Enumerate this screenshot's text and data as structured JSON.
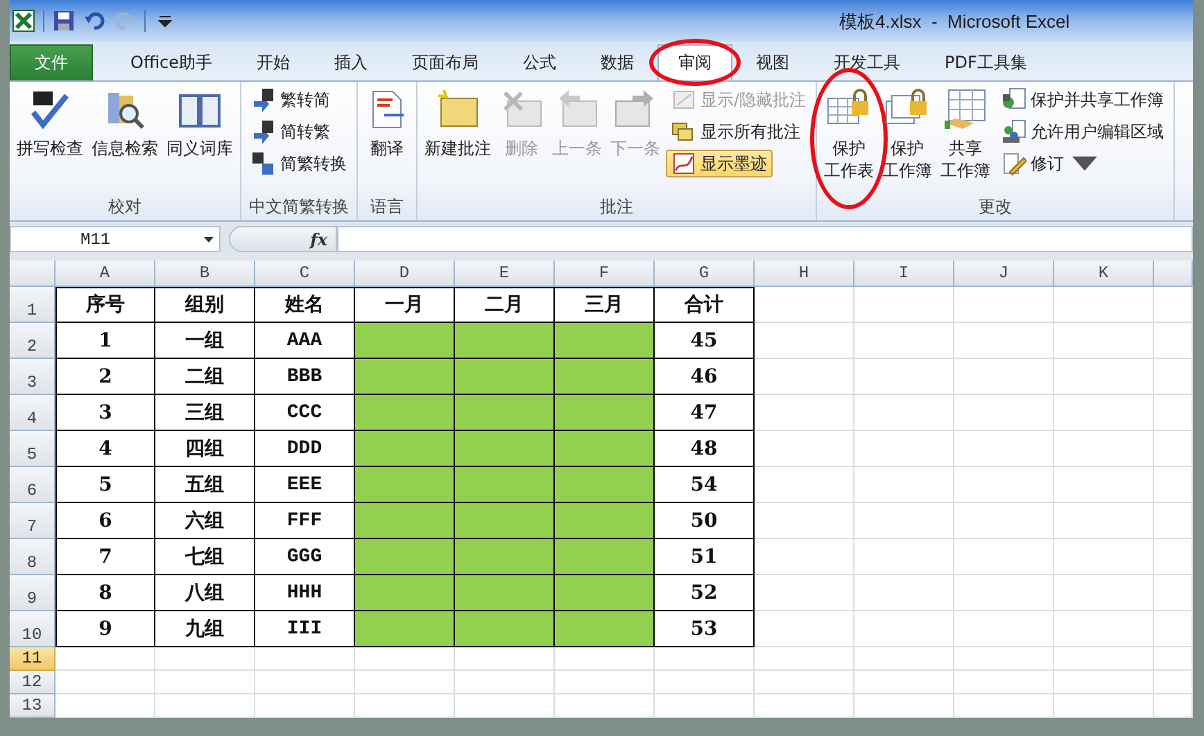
{
  "window": {
    "title": "模板4.xlsx  -  Microsoft Excel"
  },
  "tabs": [
    {
      "label": "文件",
      "kind": "file",
      "selected": false,
      "circled": false
    },
    {
      "label": "Office助手",
      "kind": "tab",
      "selected": false,
      "circled": false
    },
    {
      "label": "开始",
      "kind": "tab",
      "selected": false,
      "circled": false
    },
    {
      "label": "插入",
      "kind": "tab",
      "selected": false,
      "circled": false
    },
    {
      "label": "页面布局",
      "kind": "tab",
      "selected": false,
      "circled": false
    },
    {
      "label": "公式",
      "kind": "tab",
      "selected": false,
      "circled": false
    },
    {
      "label": "数据",
      "kind": "tab",
      "selected": false,
      "circled": false
    },
    {
      "label": "审阅",
      "kind": "tab",
      "selected": true,
      "circled": true
    },
    {
      "label": "视图",
      "kind": "tab",
      "selected": false,
      "circled": false
    },
    {
      "label": "开发工具",
      "kind": "tab",
      "selected": false,
      "circled": false
    },
    {
      "label": "PDF工具集",
      "kind": "tab",
      "selected": false,
      "circled": false
    }
  ],
  "ribbon": {
    "groups": [
      {
        "label": "校对",
        "items": [
          {
            "label": "拼写检查",
            "kind": "large",
            "disabled": false,
            "on": false,
            "circled": false
          },
          {
            "label": "信息检索",
            "kind": "large",
            "disabled": false,
            "on": false,
            "circled": false
          },
          {
            "label": "同义词库",
            "kind": "large",
            "disabled": false,
            "on": false,
            "circled": false
          }
        ]
      },
      {
        "label": "中文简繁转换",
        "items": [
          {
            "label": "繁转简",
            "kind": "small",
            "disabled": false,
            "on": false,
            "circled": false
          },
          {
            "label": "简转繁",
            "kind": "small",
            "disabled": false,
            "on": false,
            "circled": false
          },
          {
            "label": "简繁转换",
            "kind": "small",
            "disabled": false,
            "on": false,
            "circled": false
          }
        ]
      },
      {
        "label": "语言",
        "items": [
          {
            "label": "翻译",
            "kind": "large",
            "disabled": false,
            "on": false,
            "circled": false
          }
        ]
      },
      {
        "label": "批注",
        "items": [
          {
            "label": "新建批注",
            "kind": "large",
            "disabled": false,
            "on": false,
            "circled": false
          },
          {
            "label": "删除",
            "kind": "large",
            "disabled": true,
            "on": false,
            "circled": false
          },
          {
            "label": "上一条",
            "kind": "large",
            "disabled": true,
            "on": false,
            "circled": false
          },
          {
            "label": "下一条",
            "kind": "large",
            "disabled": true,
            "on": false,
            "circled": false
          },
          {
            "label": "显示/隐藏批注",
            "kind": "small",
            "disabled": true,
            "on": false,
            "circled": false
          },
          {
            "label": "显示所有批注",
            "kind": "small",
            "disabled": false,
            "on": false,
            "circled": false
          },
          {
            "label": "显示墨迹",
            "kind": "small",
            "disabled": false,
            "on": true,
            "circled": false
          }
        ]
      },
      {
        "label": "更改",
        "items": [
          {
            "lines": [
              "保护",
              "工作表"
            ],
            "kind": "large",
            "disabled": false,
            "on": false,
            "circled": true
          },
          {
            "lines": [
              "保护",
              "工作簿"
            ],
            "kind": "large",
            "disabled": false,
            "on": false,
            "circled": false
          },
          {
            "lines": [
              "共享",
              "工作簿"
            ],
            "kind": "large",
            "disabled": false,
            "on": false,
            "circled": false
          },
          {
            "label": "保护并共享工作簿",
            "kind": "small",
            "disabled": false,
            "on": false,
            "circled": false
          },
          {
            "label": "允许用户编辑区域",
            "kind": "small",
            "disabled": false,
            "on": false,
            "circled": false
          },
          {
            "label": "修订",
            "kind": "dropdown",
            "disabled": false,
            "on": false,
            "circled": false
          }
        ]
      }
    ]
  },
  "formula_bar": {
    "name_box": "M11",
    "function_label": "fx"
  },
  "sheet": {
    "columns": [
      "A",
      "B",
      "C",
      "D",
      "E",
      "F",
      "G",
      "H",
      "I",
      "J",
      "K"
    ],
    "rows": [
      {
        "number": "1",
        "selected": false,
        "cells": [
          {
            "text": "序号"
          },
          {
            "text": "组别"
          },
          {
            "text": "姓名"
          },
          {
            "text": "一月"
          },
          {
            "text": "二月"
          },
          {
            "text": "三月"
          },
          {
            "text": "合计"
          }
        ]
      },
      {
        "number": "2",
        "selected": false,
        "cells": [
          {
            "text": "1"
          },
          {
            "text": "一组"
          },
          {
            "text": "AAA"
          },
          {
            "color": "#92d050"
          },
          {
            "color": "#92d050"
          },
          {
            "color": "#92d050"
          },
          {
            "text": "45"
          }
        ]
      },
      {
        "number": "3",
        "selected": false,
        "cells": [
          {
            "text": "2"
          },
          {
            "text": "二组"
          },
          {
            "text": "BBB"
          },
          {
            "color": "#92d050"
          },
          {
            "color": "#92d050"
          },
          {
            "color": "#92d050"
          },
          {
            "text": "46"
          }
        ]
      },
      {
        "number": "4",
        "selected": false,
        "cells": [
          {
            "text": "3"
          },
          {
            "text": "三组"
          },
          {
            "text": "CCC"
          },
          {
            "color": "#92d050"
          },
          {
            "color": "#92d050"
          },
          {
            "color": "#92d050"
          },
          {
            "text": "47"
          }
        ]
      },
      {
        "number": "5",
        "selected": false,
        "cells": [
          {
            "text": "4"
          },
          {
            "text": "四组"
          },
          {
            "text": "DDD"
          },
          {
            "color": "#92d050"
          },
          {
            "color": "#92d050"
          },
          {
            "color": "#92d050"
          },
          {
            "text": "48"
          }
        ]
      },
      {
        "number": "6",
        "selected": false,
        "cells": [
          {
            "text": "5"
          },
          {
            "text": "五组"
          },
          {
            "text": "EEE"
          },
          {
            "color": "#92d050"
          },
          {
            "color": "#92d050"
          },
          {
            "color": "#92d050"
          },
          {
            "text": "54"
          }
        ]
      },
      {
        "number": "7",
        "selected": false,
        "cells": [
          {
            "text": "6"
          },
          {
            "text": "六组"
          },
          {
            "text": "FFF"
          },
          {
            "color": "#92d050"
          },
          {
            "color": "#92d050"
          },
          {
            "color": "#92d050"
          },
          {
            "text": "50"
          }
        ]
      },
      {
        "number": "8",
        "selected": false,
        "cells": [
          {
            "text": "7"
          },
          {
            "text": "七组"
          },
          {
            "text": "GGG"
          },
          {
            "color": "#92d050"
          },
          {
            "color": "#92d050"
          },
          {
            "color": "#92d050"
          },
          {
            "text": "51"
          }
        ]
      },
      {
        "number": "9",
        "selected": false,
        "cells": [
          {
            "text": "8"
          },
          {
            "text": "八组"
          },
          {
            "text": "HHH"
          },
          {
            "color": "#92d050"
          },
          {
            "color": "#92d050"
          },
          {
            "color": "#92d050"
          },
          {
            "text": "52"
          }
        ]
      },
      {
        "number": "10",
        "selected": false,
        "cells": [
          {
            "text": "9"
          },
          {
            "text": "九组"
          },
          {
            "text": "III"
          },
          {
            "color": "#92d050"
          },
          {
            "color": "#92d050"
          },
          {
            "color": "#92d050"
          },
          {
            "text": "53"
          }
        ]
      },
      {
        "number": "11",
        "selected": true,
        "cells": []
      },
      {
        "number": "12",
        "selected": false,
        "cells": []
      },
      {
        "number": "13",
        "selected": false,
        "cells": []
      }
    ]
  }
}
